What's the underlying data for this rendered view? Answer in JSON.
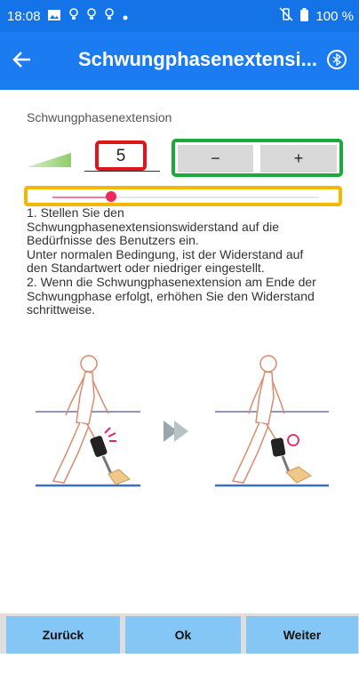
{
  "status_bar": {
    "time": "18:08",
    "icons": [
      "image-icon",
      "lightbulb-icon",
      "lightbulb-icon",
      "lightbulb-icon",
      "dot-icon"
    ],
    "vibrate_icon": "vibrate-off-icon",
    "battery_icon": "battery-icon",
    "battery": "100 %"
  },
  "app_bar": {
    "title": "Schwungphasenextensi...",
    "back_icon": "arrow-left-icon",
    "bluetooth_icon": "bluetooth-icon",
    "color": "#1b7cf2"
  },
  "setting": {
    "label": "Schwungphasenextension",
    "value": "5",
    "minus_label": "−",
    "plus_label": "+",
    "slider_level": 0.22,
    "highlight_colors": {
      "value": "#e0141a",
      "stepper": "#1aab3b",
      "slider": "#f5b800"
    }
  },
  "instructions": [
    "1. Stellen Sie den",
    "Schwungphasenextensionswiderstand auf die",
    "Bedürfnisse des Benutzers ein.",
    "Unter normalen Bedingung, ist der Widerstand auf",
    "den Standartwert oder niedriger eingestellt.",
    "2. Wenn die Schwungphasenextension am Ende der",
    "Schwungphase erfolgt, erhöhen Sie den Widerstand",
    "schrittweise."
  ],
  "nav": {
    "back": "Zurück",
    "ok": "Ok",
    "next": "Weiter",
    "button_color": "#84c6f6"
  }
}
